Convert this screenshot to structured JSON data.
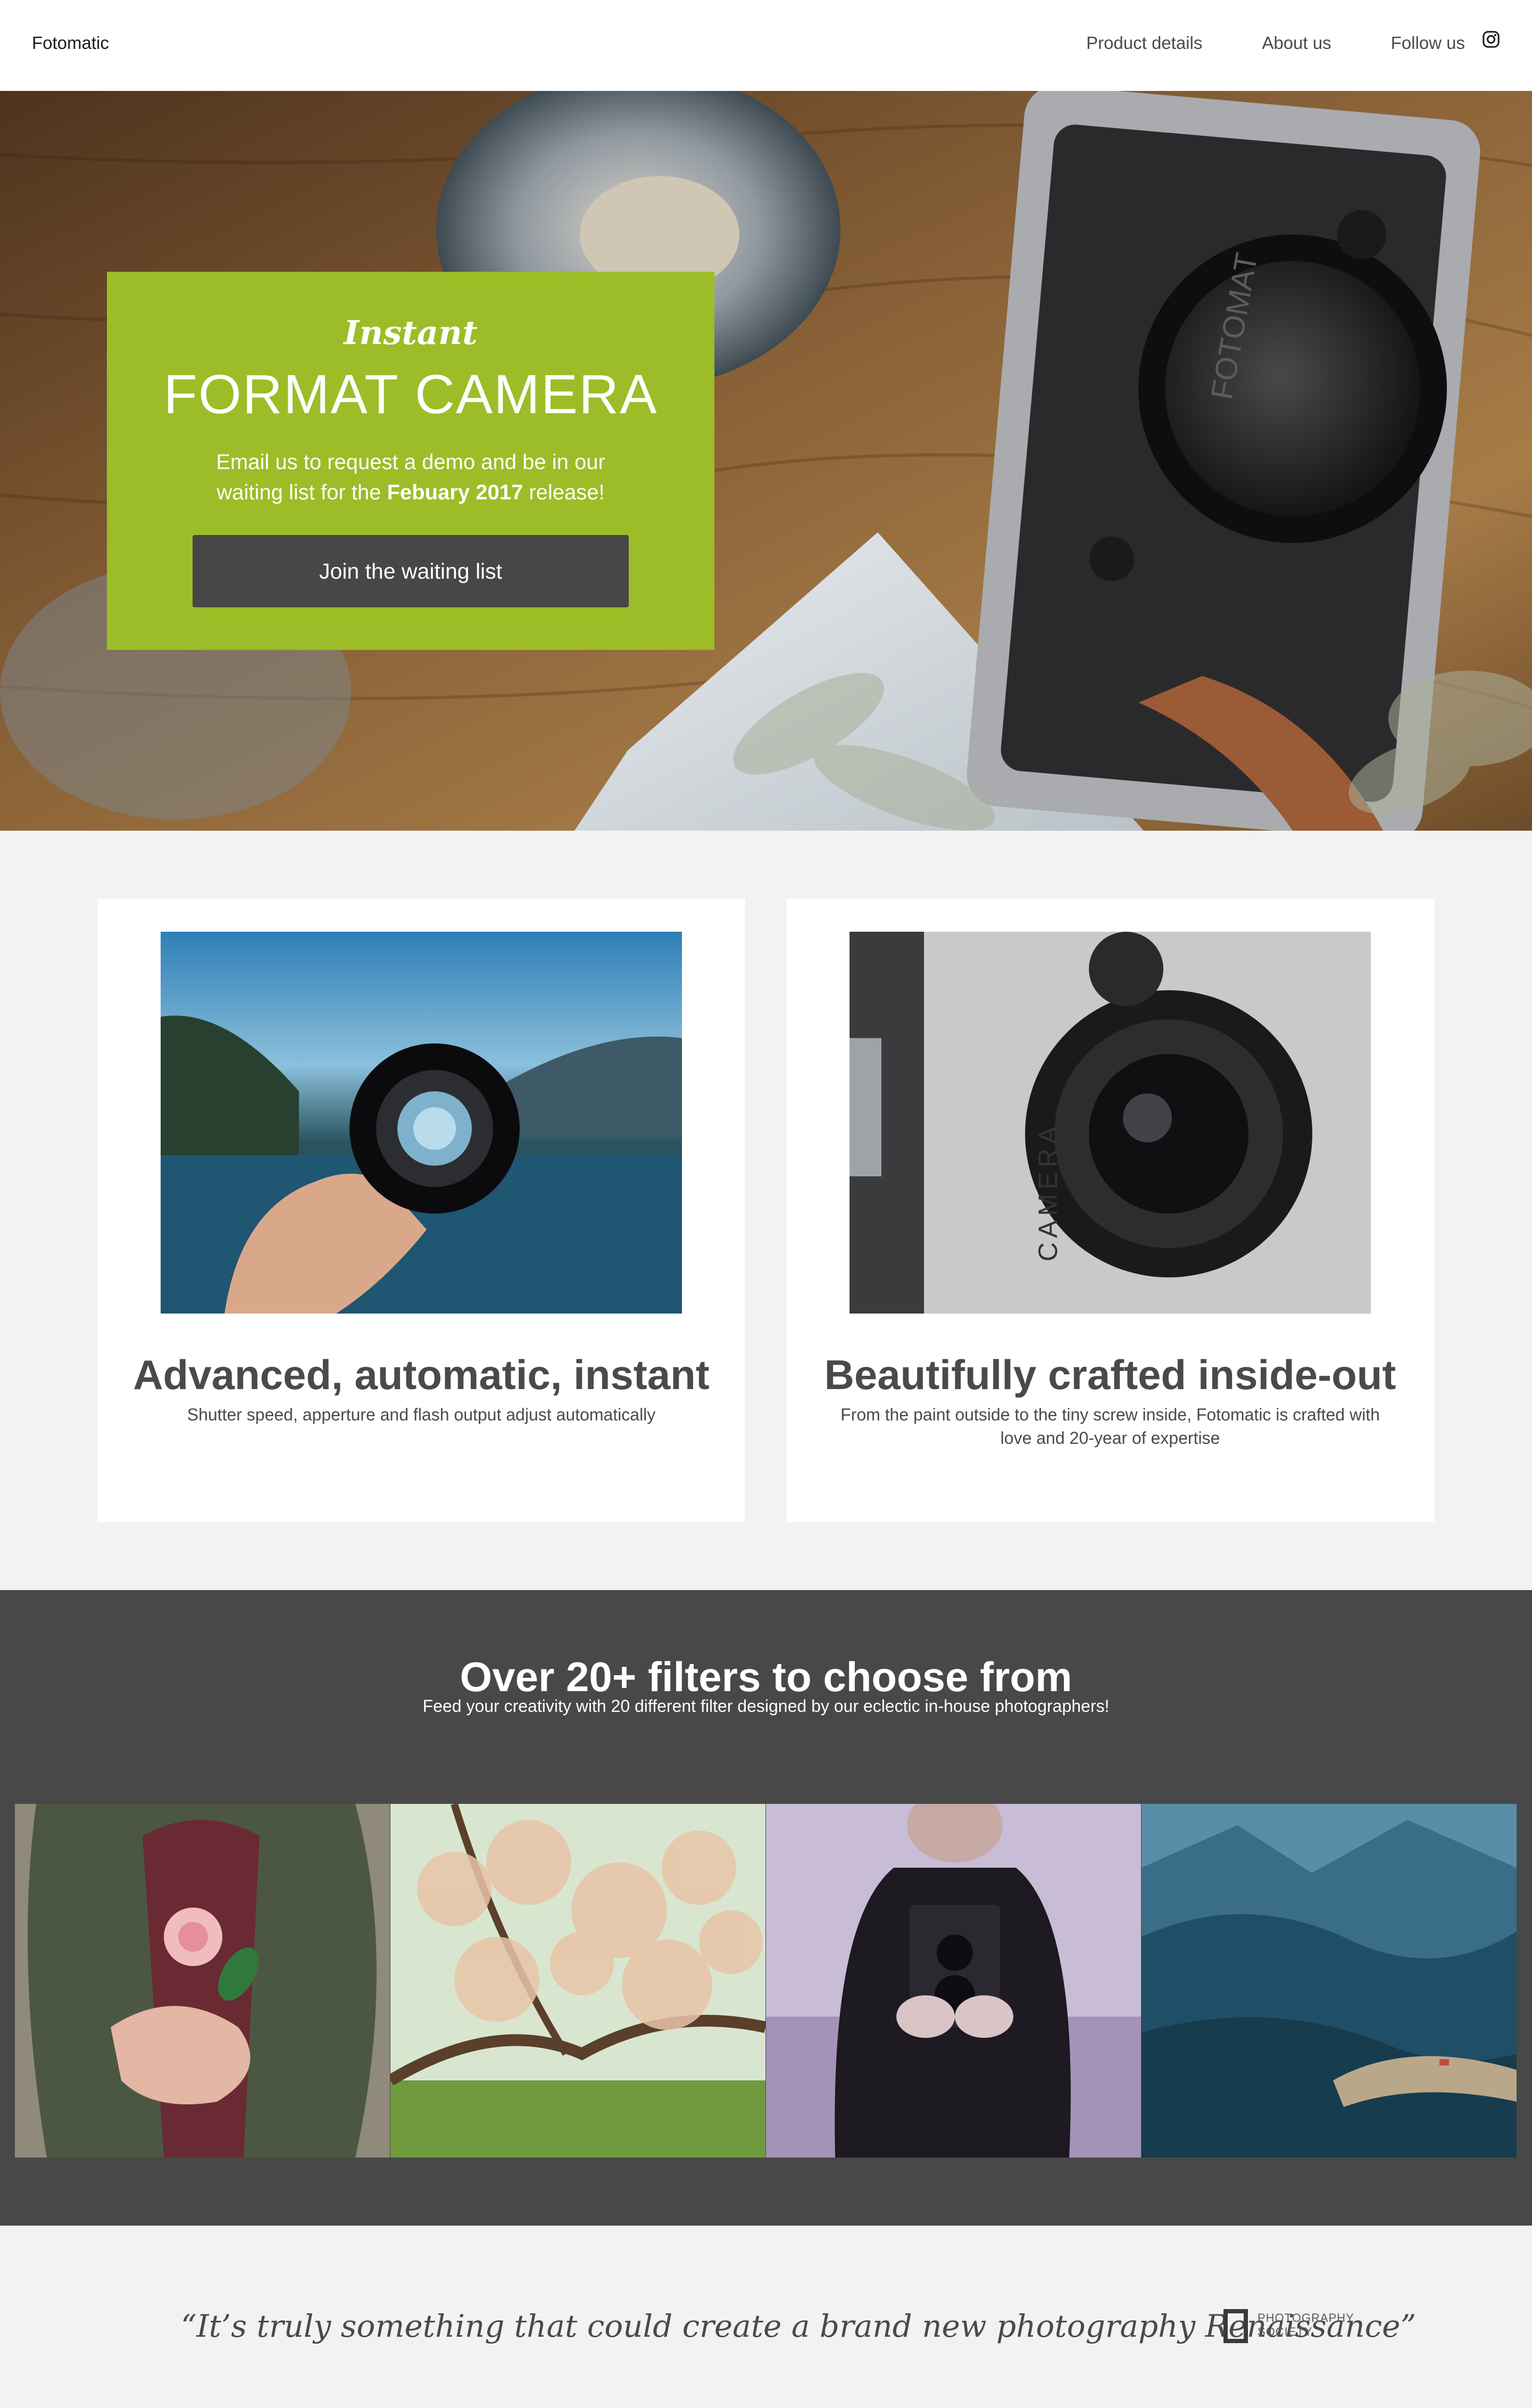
{
  "nav": {
    "brand": "Fotomatic",
    "links": [
      "Product details",
      "About us",
      "Follow us"
    ],
    "social_icon": "instagram-icon"
  },
  "hero": {
    "script_title": "Instant",
    "headline": "FORMAT CAMERA",
    "desc_part1": "Email us to request a demo and be in our waiting list for the ",
    "desc_bold": "Febuary 2017",
    "desc_part2": " release!",
    "cta_label": "Join the waiting list",
    "card_color": "#9cbd27",
    "camera_brand_text": "FOTOMAT"
  },
  "features": [
    {
      "title": "Advanced, automatic, instant",
      "text": "Shutter speed, apperture and flash output adjust automatically",
      "image": "hand-holding-lens-photo"
    },
    {
      "title": "Beautifully crafted inside-out",
      "text": "From the paint outside to the tiny screw inside, Fotomatic is crafted with love and 20-year of expertise",
      "image": "camera-lens-closeup-photo"
    }
  ],
  "filters": {
    "title": "Over 20+ filters to choose from",
    "subtitle": "Feed your creativity with 20 different filter designed by our eclectic in-house photographers!",
    "images": [
      "person-holding-flower-photo",
      "blossom-tree-photo",
      "person-with-twin-lens-camera-photo",
      "mountain-valley-photo"
    ]
  },
  "quote": {
    "text": "“It’s truly something that could create a brand new photography Renaissance”",
    "logo_line1": "PHOTOGRAPHY",
    "logo_line2": "SOCIETY"
  }
}
